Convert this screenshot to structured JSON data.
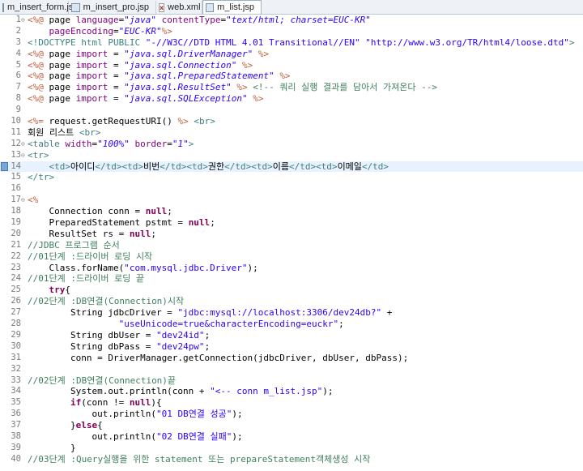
{
  "tabs": [
    {
      "label": "m_insert_form.jsp",
      "icon": "jsp-file-icon",
      "active": false
    },
    {
      "label": "m_insert_pro.jsp",
      "icon": "jsp-file-icon",
      "active": false
    },
    {
      "label": "web.xml",
      "icon": "xml-file-icon",
      "active": false
    },
    {
      "label": "m_list.jsp",
      "icon": "jsp-file-icon",
      "active": true
    }
  ],
  "editor": {
    "current_line": 14,
    "colors": {
      "directive": "#bf5f3f",
      "string": "#2a00ff",
      "comment": "#3f7f5f",
      "tag": "#3f7f7f",
      "attribute": "#7f007f",
      "keyword": "#7f0055",
      "highlight": "#e8f2fe"
    },
    "lines": [
      [
        [
          "d",
          "<%@ "
        ],
        [
          "",
          "page "
        ],
        [
          "a",
          "language"
        ],
        [
          "",
          "="
        ],
        [
          "s i",
          "\"java\""
        ],
        [
          "",
          " "
        ],
        [
          "a",
          "contentType"
        ],
        [
          "",
          "="
        ],
        [
          "s i",
          "\"text/html; charset=EUC-KR\""
        ]
      ],
      [
        [
          "",
          "    "
        ],
        [
          "a",
          "pageEncoding"
        ],
        [
          "",
          "="
        ],
        [
          "s i",
          "\"EUC-KR\""
        ],
        [
          "d",
          "%>"
        ]
      ],
      [
        [
          "t",
          "<!DOCTYPE html PUBLIC "
        ],
        [
          "s",
          "\"-//W3C//DTD HTML 4.01 Transitional//EN\""
        ],
        [
          "",
          " "
        ],
        [
          "s",
          "\"http://www.w3.org/TR/html4/loose.dtd\""
        ],
        [
          "t",
          ">"
        ]
      ],
      [
        [
          "d",
          "<%@ "
        ],
        [
          "",
          "page "
        ],
        [
          "a",
          "import"
        ],
        [
          "",
          " = "
        ],
        [
          "s i",
          "\"java.sql.DriverManager\""
        ],
        [
          "",
          " "
        ],
        [
          "d",
          "%>"
        ]
      ],
      [
        [
          "d",
          "<%@ "
        ],
        [
          "",
          "page "
        ],
        [
          "a",
          "import"
        ],
        [
          "",
          " = "
        ],
        [
          "s i",
          "\"java.sql.Connection\""
        ],
        [
          "",
          " "
        ],
        [
          "d",
          "%>"
        ]
      ],
      [
        [
          "d",
          "<%@ "
        ],
        [
          "",
          "page "
        ],
        [
          "a",
          "import"
        ],
        [
          "",
          " = "
        ],
        [
          "s i",
          "\"java.sql.PreparedStatement\""
        ],
        [
          "",
          " "
        ],
        [
          "d",
          "%>"
        ]
      ],
      [
        [
          "d",
          "<%@ "
        ],
        [
          "",
          "page "
        ],
        [
          "a",
          "import"
        ],
        [
          "",
          " = "
        ],
        [
          "s i",
          "\"java.sql.ResultSet\""
        ],
        [
          "",
          " "
        ],
        [
          "d",
          "%>"
        ],
        [
          "",
          " "
        ],
        [
          "c",
          "<!-- 쿼리 실행 결과를 담아서 가져온다 -->"
        ]
      ],
      [
        [
          "d",
          "<%@ "
        ],
        [
          "",
          "page "
        ],
        [
          "a",
          "import"
        ],
        [
          "",
          " = "
        ],
        [
          "s i",
          "\"java.sql.SQLException\""
        ],
        [
          "",
          " "
        ],
        [
          "d",
          "%>"
        ]
      ],
      [],
      [
        [
          "d",
          "<%="
        ],
        [
          "",
          " request.getRequestURI() "
        ],
        [
          "d",
          "%>"
        ],
        [
          "",
          " "
        ],
        [
          "t",
          "<br>"
        ]
      ],
      [
        [
          "",
          "회원 리스트 "
        ],
        [
          "t",
          "<br>"
        ]
      ],
      [
        [
          "t",
          "<table "
        ],
        [
          "a",
          "width"
        ],
        [
          "",
          "="
        ],
        [
          "s i",
          "\"100%\""
        ],
        [
          "",
          " "
        ],
        [
          "a",
          "border"
        ],
        [
          "",
          "="
        ],
        [
          "s i",
          "\"1\""
        ],
        [
          "t",
          ">"
        ]
      ],
      [
        [
          "t",
          "<tr>"
        ]
      ],
      [
        [
          "",
          "    "
        ],
        [
          "t",
          "<td>"
        ],
        [
          "",
          "아이디"
        ],
        [
          "t",
          "</td><td>"
        ],
        [
          "",
          "비번"
        ],
        [
          "t",
          "</td><td>"
        ],
        [
          "",
          "권한"
        ],
        [
          "t",
          "</td><td>"
        ],
        [
          "",
          "이름"
        ],
        [
          "t",
          "</td><td>"
        ],
        [
          "",
          "이메일"
        ],
        [
          "t",
          "</td>"
        ]
      ],
      [
        [
          "t",
          "</tr>"
        ]
      ],
      [],
      [
        [
          "d",
          "<%"
        ]
      ],
      [
        [
          "",
          "    Connection conn = "
        ],
        [
          "k",
          "null"
        ],
        [
          "",
          ";"
        ]
      ],
      [
        [
          "",
          "    PreparedStatement pstmt = "
        ],
        [
          "k",
          "null"
        ],
        [
          "",
          ";"
        ]
      ],
      [
        [
          "",
          "    ResultSet rs = "
        ],
        [
          "k",
          "null"
        ],
        [
          "",
          ";"
        ]
      ],
      [
        [
          "c",
          "//JDBC 프로그램 순서"
        ]
      ],
      [
        [
          "c",
          "//01단계 :드라이버 로딩 시작"
        ]
      ],
      [
        [
          "",
          "    Class.forName("
        ],
        [
          "s",
          "\"com.mysql.jdbc.Driver\""
        ],
        [
          "",
          ");"
        ]
      ],
      [
        [
          "c",
          "//01단계 :드라이버 로딩 끝"
        ]
      ],
      [
        [
          "",
          "    "
        ],
        [
          "k",
          "try"
        ],
        [
          "",
          "{"
        ]
      ],
      [
        [
          "c",
          "//02단계 :DB연결(Connection)시작"
        ]
      ],
      [
        [
          "",
          "        String jdbcDriver = "
        ],
        [
          "s",
          "\"jdbc:mysql://localhost:3306/dev24db?\""
        ],
        [
          "",
          " +"
        ]
      ],
      [
        [
          "",
          "                 "
        ],
        [
          "s",
          "\"useUnicode=true&characterEncoding=euckr\""
        ],
        [
          "",
          ";"
        ]
      ],
      [
        [
          "",
          "        String dbUser = "
        ],
        [
          "s",
          "\"dev24id\""
        ],
        [
          "",
          ";"
        ]
      ],
      [
        [
          "",
          "        String dbPass = "
        ],
        [
          "s",
          "\"dev24pw\""
        ],
        [
          "",
          ";"
        ]
      ],
      [
        [
          "",
          "        conn = DriverManager.getConnection(jdbcDriver, dbUser, dbPass);"
        ]
      ],
      [],
      [
        [
          "c",
          "//02단계 :DB연결(Connection)끝"
        ]
      ],
      [
        [
          "",
          "        System.out.println(conn + "
        ],
        [
          "s",
          "\"<-- conn m_list.jsp\""
        ],
        [
          "",
          ");"
        ]
      ],
      [
        [
          "",
          "        "
        ],
        [
          "k",
          "if"
        ],
        [
          "",
          "(conn != "
        ],
        [
          "k",
          "null"
        ],
        [
          "",
          "){"
        ]
      ],
      [
        [
          "",
          "            out.println("
        ],
        [
          "s",
          "\"01 DB연결 성공\""
        ],
        [
          "",
          ");"
        ]
      ],
      [
        [
          "",
          "        }"
        ],
        [
          "k",
          "else"
        ],
        [
          "",
          "{"
        ]
      ],
      [
        [
          "",
          "            out.println("
        ],
        [
          "s",
          "\"02 DB연결 실패\""
        ],
        [
          "",
          ");"
        ]
      ],
      [
        [
          "",
          "        }"
        ]
      ],
      [
        [
          "c",
          "//03단계 :Query실행을 위한 statement 또는 prepareStatement객체생성 시작"
        ]
      ]
    ]
  }
}
